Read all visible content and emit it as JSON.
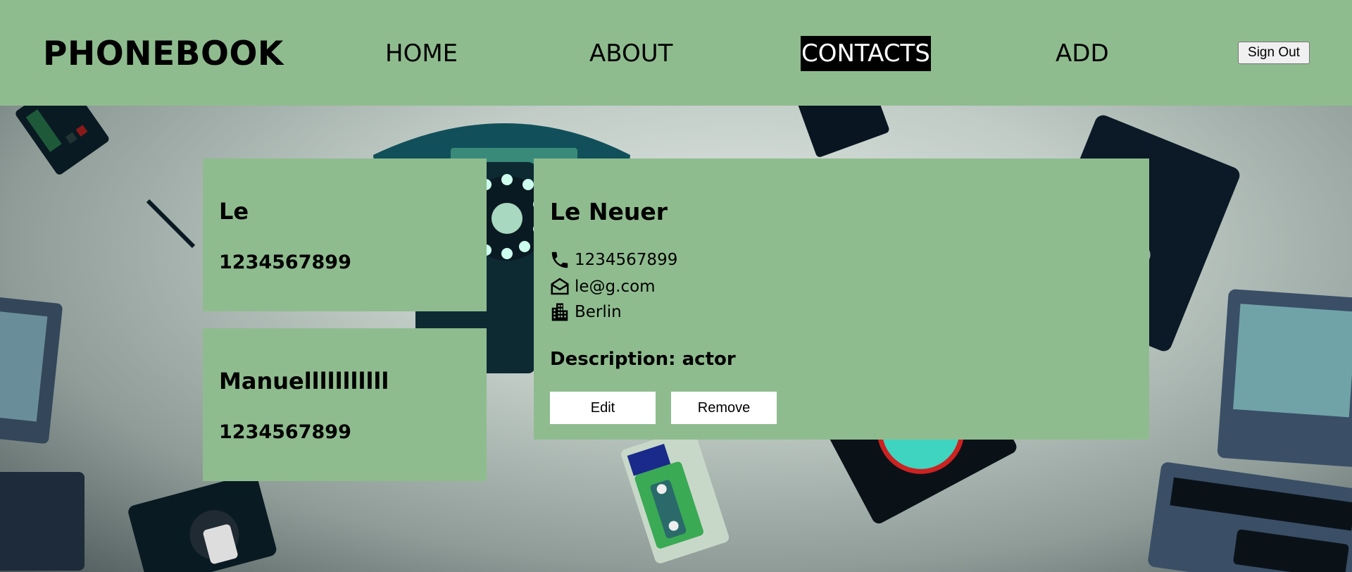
{
  "header": {
    "logo": "PHONEBOOK",
    "nav": {
      "home": "HOME",
      "about": "ABOUT",
      "contacts": "CONTACTS",
      "add": "ADD"
    },
    "active_nav": "CONTACTS",
    "sign_out_label": "Sign Out"
  },
  "contacts": [
    {
      "name": "Le",
      "phone": "1234567899"
    },
    {
      "name": "Manuelllllllllll",
      "phone": "1234567899"
    }
  ],
  "detail": {
    "name": "Le Neuer",
    "phone": "1234567899",
    "email": "le@g.com",
    "city": "Berlin",
    "description": "Description: actor",
    "edit_label": "Edit",
    "remove_label": "Remove"
  },
  "icons": {
    "phone": "phone-icon",
    "email": "envelope-open-icon",
    "city": "buildings-icon"
  },
  "colors": {
    "header_bg": "#8fbc8f",
    "card_bg": "#8fbc8f",
    "active_nav_bg": "#000000",
    "active_nav_text": "#ffffff"
  }
}
